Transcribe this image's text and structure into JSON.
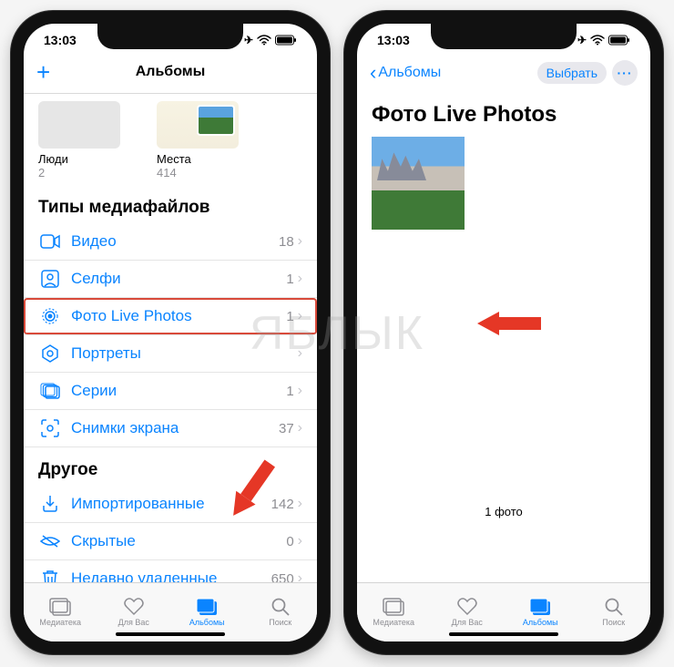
{
  "statusbar": {
    "time": "13:03"
  },
  "left_phone": {
    "nav": {
      "title": "Альбомы"
    },
    "albums": {
      "people": {
        "label": "Люди",
        "count": "2"
      },
      "places": {
        "label": "Места",
        "count": "414"
      }
    },
    "media_types_header": "Типы медиафайлов",
    "media": [
      {
        "icon": "video",
        "label": "Видео",
        "count": "18"
      },
      {
        "icon": "selfie",
        "label": "Селфи",
        "count": "1"
      },
      {
        "icon": "live",
        "label": "Фото Live Photos",
        "count": "1"
      },
      {
        "icon": "portrait",
        "label": "Портреты",
        "count": ""
      },
      {
        "icon": "burst",
        "label": "Серии",
        "count": "1"
      },
      {
        "icon": "screenshot",
        "label": "Снимки экрана",
        "count": "37"
      }
    ],
    "other_header": "Другое",
    "other": [
      {
        "icon": "import",
        "label": "Импортированные",
        "count": "142"
      },
      {
        "icon": "hidden",
        "label": "Скрытые",
        "count": "0"
      },
      {
        "icon": "trash",
        "label": "Недавно удаленные",
        "count": "650"
      }
    ]
  },
  "right_phone": {
    "nav": {
      "back": "Альбомы",
      "select": "Выбрать"
    },
    "title": "Фото Live Photos",
    "footer_count": "1 фото"
  },
  "tabs": {
    "library": "Медиатека",
    "foryou": "Для Вас",
    "albums": "Альбомы",
    "search": "Поиск"
  },
  "watermark": "ЯБЛЫК"
}
